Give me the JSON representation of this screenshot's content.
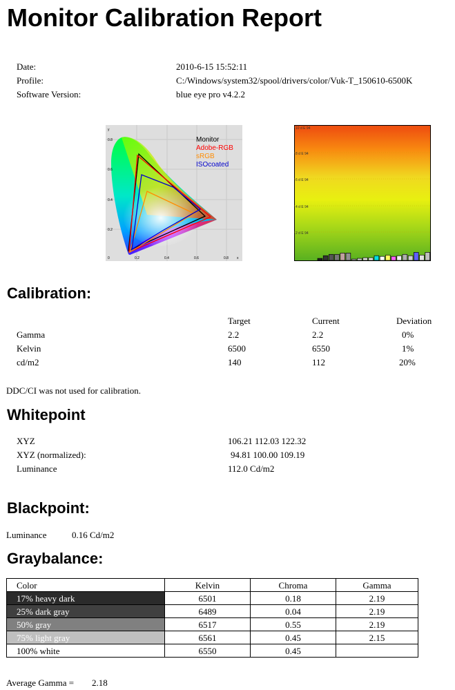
{
  "title": "Monitor Calibration Report",
  "meta": {
    "date_label": "Date:",
    "date_value": "2010-6-15 15:52:11",
    "profile_label": "Profile:",
    "profile_value": "C:/Windows/system32/spool/drivers/color/Vuk-T_150610-6500K",
    "software_label": "Software Version:",
    "software_value": "blue eye pro v4.2.2"
  },
  "gamut_chart": {
    "legend": [
      "Monitor",
      "Adobe-RGB",
      "sRGB",
      "ISOcoated"
    ],
    "legend_colors": [
      "#000000",
      "#ff0000",
      "#ff8c00",
      "#0000cc"
    ],
    "x_ticks": [
      "0",
      "0.2",
      "0.4",
      "0.6",
      "0.8",
      "x"
    ],
    "y_ticks": [
      "y",
      "0.8",
      "0.6",
      "0.4",
      "0.2"
    ]
  },
  "deltae_chart": {
    "y_ticks": [
      "10 d E 94",
      "8 d E 94",
      "6 d E 94",
      "4 d E 94",
      "2 d E 94"
    ],
    "bar_values": [
      0.15,
      0.35,
      0.45,
      0.45,
      0.55,
      0.55,
      0.1,
      0.15,
      0.2,
      0.2,
      0.35,
      0.3,
      0.4,
      0.3,
      0.35,
      0.45,
      0.35,
      0.6,
      0.4,
      0.6
    ],
    "bar_colors": [
      "#222222",
      "#333333",
      "#555555",
      "#777777",
      "#c0a0a0",
      "#909090",
      "#bbbbbb",
      "#cfcfcf",
      "#d8d8d8",
      "#e0e0e0",
      "#00e0e0",
      "#ffffff",
      "#ffff60",
      "#ff60ff",
      "#f0f0f0",
      "#b0b0b0",
      "#d0d0d0",
      "#6060ff",
      "#e0e0e0",
      "#c0c0c0"
    ]
  },
  "calibration": {
    "heading": "Calibration:",
    "col_target": "Target",
    "col_current": "Current",
    "col_deviation": "Deviation",
    "rows": [
      {
        "label": "Gamma",
        "target": "2.2",
        "current": "2.2",
        "deviation": "0%"
      },
      {
        "label": "Kelvin",
        "target": "6500",
        "current": "6550",
        "deviation": "1%"
      },
      {
        "label": "cd/m2",
        "target": "140",
        "current": "112",
        "deviation": "20%"
      }
    ],
    "ddc_note": "DDC/CI was not used for calibration."
  },
  "whitepoint": {
    "heading": "Whitepoint",
    "xyz_label": "XYZ",
    "xyz_value": "106.21 112.03 122.32",
    "xyz_norm_label": "XYZ (normalized):",
    "xyz_norm_value": "94.81 100.00 109.19",
    "lum_label": "Luminance",
    "lum_value": "112.0 Cd/m2"
  },
  "blackpoint": {
    "heading": "Blackpoint:",
    "lum_label": "Luminance",
    "lum_value": "0.16 Cd/m2"
  },
  "graybalance": {
    "heading": "Graybalance:",
    "headers": [
      "Color",
      "Kelvin",
      "Chroma",
      "Gamma"
    ],
    "rows": [
      {
        "color": "17% heavy dark",
        "kelvin": "6501",
        "chroma": "0.18",
        "gamma": "2.19",
        "swatch": "#2b2b2b",
        "text_color": "#ffffff"
      },
      {
        "color": "25% dark gray",
        "kelvin": "6489",
        "chroma": "0.04",
        "gamma": "2.19",
        "swatch": "#404040",
        "text_color": "#ffffff"
      },
      {
        "color": "50% gray",
        "kelvin": "6517",
        "chroma": "0.55",
        "gamma": "2.19",
        "swatch": "#808080",
        "text_color": "#ffffff"
      },
      {
        "color": "75% light gray",
        "kelvin": "6561",
        "chroma": "0.45",
        "gamma": "2.15",
        "swatch": "#bfbfbf",
        "text_color": "#ffffff"
      },
      {
        "color": "100% white",
        "kelvin": "6550",
        "chroma": "0.45",
        "gamma": "",
        "swatch": "#ffffff",
        "text_color": "#000000"
      }
    ],
    "avg_label": "Average Gamma =",
    "avg_value": "2.18"
  }
}
